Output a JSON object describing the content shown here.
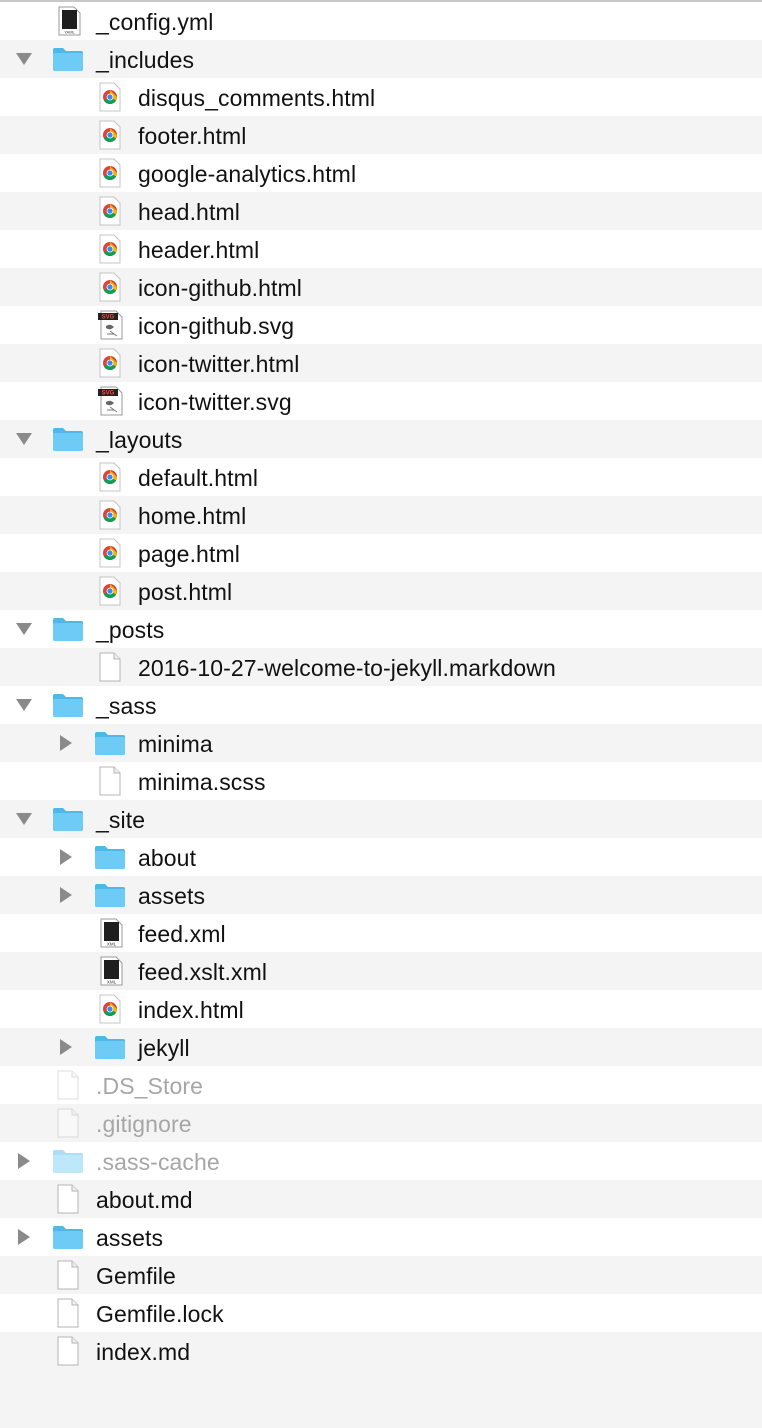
{
  "colors": {
    "folder": "#6ecbf5",
    "folder_dark": "#4db8ea",
    "row_alt": "#f4f4f4",
    "dim_text": "#a6a6a6",
    "chrome_red": "#db4437",
    "chrome_green": "#0f9d58",
    "chrome_yellow": "#f4b400",
    "chrome_blue": "#4285f4"
  },
  "tree": [
    {
      "name": "_config.yml",
      "depth": 1,
      "type": "yaml"
    },
    {
      "name": "_includes",
      "depth": 1,
      "type": "folder",
      "expanded": true
    },
    {
      "name": "disqus_comments.html",
      "depth": 2,
      "type": "chrome"
    },
    {
      "name": "footer.html",
      "depth": 2,
      "type": "chrome"
    },
    {
      "name": "google-analytics.html",
      "depth": 2,
      "type": "chrome"
    },
    {
      "name": "head.html",
      "depth": 2,
      "type": "chrome"
    },
    {
      "name": "header.html",
      "depth": 2,
      "type": "chrome"
    },
    {
      "name": "icon-github.html",
      "depth": 2,
      "type": "chrome"
    },
    {
      "name": "icon-github.svg",
      "depth": 2,
      "type": "svg"
    },
    {
      "name": "icon-twitter.html",
      "depth": 2,
      "type": "chrome"
    },
    {
      "name": "icon-twitter.svg",
      "depth": 2,
      "type": "svg"
    },
    {
      "name": "_layouts",
      "depth": 1,
      "type": "folder",
      "expanded": true
    },
    {
      "name": "default.html",
      "depth": 2,
      "type": "chrome"
    },
    {
      "name": "home.html",
      "depth": 2,
      "type": "chrome"
    },
    {
      "name": "page.html",
      "depth": 2,
      "type": "chrome"
    },
    {
      "name": "post.html",
      "depth": 2,
      "type": "chrome"
    },
    {
      "name": "_posts",
      "depth": 1,
      "type": "folder",
      "expanded": true
    },
    {
      "name": "2016-10-27-welcome-to-jekyll.markdown",
      "depth": 2,
      "type": "doc"
    },
    {
      "name": "_sass",
      "depth": 1,
      "type": "folder",
      "expanded": true
    },
    {
      "name": "minima",
      "depth": 2,
      "type": "folder",
      "expanded": false
    },
    {
      "name": "minima.scss",
      "depth": 2,
      "type": "doc"
    },
    {
      "name": "_site",
      "depth": 1,
      "type": "folder",
      "expanded": true
    },
    {
      "name": "about",
      "depth": 2,
      "type": "folder",
      "expanded": false
    },
    {
      "name": "assets",
      "depth": 2,
      "type": "folder",
      "expanded": false
    },
    {
      "name": "feed.xml",
      "depth": 2,
      "type": "xml"
    },
    {
      "name": "feed.xslt.xml",
      "depth": 2,
      "type": "xml"
    },
    {
      "name": "index.html",
      "depth": 2,
      "type": "chrome"
    },
    {
      "name": "jekyll",
      "depth": 2,
      "type": "folder",
      "expanded": false
    },
    {
      "name": ".DS_Store",
      "depth": 1,
      "type": "doc",
      "dim": true
    },
    {
      "name": ".gitignore",
      "depth": 1,
      "type": "doc",
      "dim": true
    },
    {
      "name": ".sass-cache",
      "depth": 1,
      "type": "folder",
      "expanded": false,
      "dim": true
    },
    {
      "name": "about.md",
      "depth": 1,
      "type": "doc"
    },
    {
      "name": "assets",
      "depth": 1,
      "type": "folder",
      "expanded": false
    },
    {
      "name": "Gemfile",
      "depth": 1,
      "type": "doc"
    },
    {
      "name": "Gemfile.lock",
      "depth": 1,
      "type": "doc"
    },
    {
      "name": "index.md",
      "depth": 1,
      "type": "doc"
    }
  ],
  "icon_badges": {
    "yaml": "YAML",
    "xml": "XML",
    "svg": "SVG"
  }
}
